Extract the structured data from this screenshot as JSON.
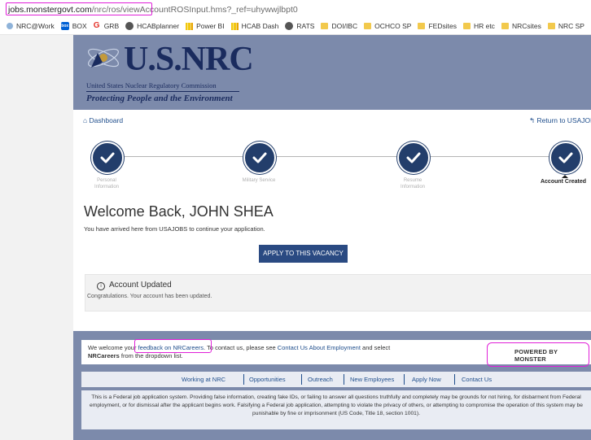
{
  "browser": {
    "url_domain": "jobs.monstergovt.com",
    "url_path": "/nrc/ros/viewAccountROSInput.hms?_ref=uhywwjlbpt0"
  },
  "bookmarks": [
    {
      "icon": "nrc-icon",
      "label": "NRC@Work"
    },
    {
      "icon": "box-icon",
      "label": "BOX"
    },
    {
      "icon": "grb-icon",
      "label": "GRB"
    },
    {
      "icon": "globe-icon",
      "label": "HCABplanner"
    },
    {
      "icon": "powerbi-icon",
      "label": "Power BI"
    },
    {
      "icon": "powerbi-icon",
      "label": "HCAB Dash"
    },
    {
      "icon": "globe-icon",
      "label": "RATS"
    },
    {
      "icon": "folder-icon",
      "label": "DOI/IBC"
    },
    {
      "icon": "folder-icon",
      "label": "OCHCO SP"
    },
    {
      "icon": "folder-icon",
      "label": "FEDsites"
    },
    {
      "icon": "folder-icon",
      "label": "HR etc"
    },
    {
      "icon": "folder-icon",
      "label": "NRCsites"
    },
    {
      "icon": "folder-icon",
      "label": "NRC SP"
    }
  ],
  "header": {
    "logo_name": "U.S.NRC",
    "logo_subtitle": "United States Nuclear Regulatory Commission",
    "tagline": "Protecting People and the Environment"
  },
  "nav": {
    "dashboard": "Dashboard",
    "return": "Return to USAJOBS"
  },
  "steps": [
    {
      "line1": "Personal",
      "line2": "Information"
    },
    {
      "line1": "Military Service",
      "line2": ""
    },
    {
      "line1": "Resume",
      "line2": "Information"
    },
    {
      "line1": "Account Created",
      "line2": ""
    }
  ],
  "main": {
    "welcome": "Welcome Back, JOHN SHEA",
    "arrived": "You have arrived here from USAJOBS to continue your application.",
    "apply_button": "APPLY TO THIS VACANCY",
    "panel_title": "Account Updated",
    "panel_message": "Congratulations. Your account has been updated."
  },
  "footer": {
    "fb_prefix": "We welcome your ",
    "fb_link": "feedback on NRCareers",
    "fb_mid": ". To contact us, please see ",
    "fb_link2": "Contact Us About Employment",
    "fb_suffix": " and select",
    "fb_bold": "NRCareers",
    "fb_end": " from the dropdown list.",
    "powered": "POWERED BY MONSTER",
    "links": [
      "Working at NRC",
      "Opportunities",
      "Outreach",
      "New Employees",
      "Apply Now",
      "Contact Us"
    ],
    "disclaimer": "This is a Federal job application system. Providing false information, creating fake IDs, or failing to answer all questions truthfully and completely may be grounds for not hiring, for disbarment from Federal employment, or for dismissal after the applicant begins work. Falsifying a Federal job application, attempting to violate the privacy of others, or attempting to compromise the operation of this system may be punishable by fine or imprisonment (US Code, Title 18, section 1001)."
  },
  "colors": {
    "banner": "#7c8aab",
    "step_circle": "#233e6b",
    "button": "#2a4a82",
    "annotation": "#e020d8"
  }
}
